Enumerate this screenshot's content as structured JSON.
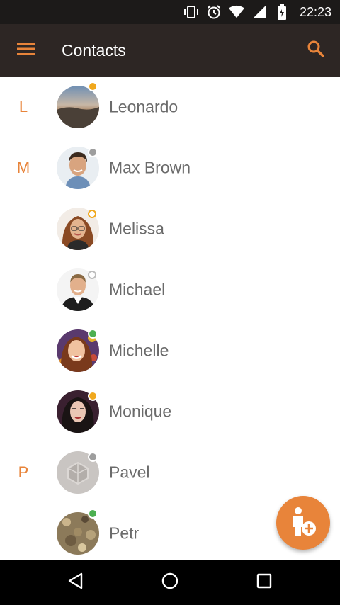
{
  "status_bar": {
    "time": "22:23",
    "icons": [
      "vibrate-icon",
      "alarm-icon",
      "wifi-icon",
      "signal-icon",
      "battery-icon"
    ]
  },
  "app_bar": {
    "title": "Contacts",
    "menu_icon": "hamburger-menu-icon",
    "search_icon": "search-icon"
  },
  "colors": {
    "accent": "#e8843a",
    "app_bar": "#2d2624",
    "status_bar": "#1c1a19",
    "online": "#4caf50",
    "away": "#f0a81e",
    "offline": "#9e9e9e"
  },
  "contacts": [
    {
      "letter": "L",
      "name": "Leonardo",
      "status": "away"
    },
    {
      "letter": "M",
      "name": "Max Brown",
      "status": "offline"
    },
    {
      "letter": "",
      "name": "Melissa",
      "status": "away-ring"
    },
    {
      "letter": "",
      "name": "Michael",
      "status": "offline-ring"
    },
    {
      "letter": "",
      "name": "Michelle",
      "status": "online"
    },
    {
      "letter": "",
      "name": "Monique",
      "status": "away"
    },
    {
      "letter": "P",
      "name": "Pavel",
      "status": "offline"
    },
    {
      "letter": "",
      "name": "Petr",
      "status": "online"
    }
  ],
  "fab": {
    "icon": "add-contact-icon"
  },
  "nav_bar": {
    "icons": [
      "back-icon",
      "home-icon",
      "recents-icon"
    ]
  }
}
